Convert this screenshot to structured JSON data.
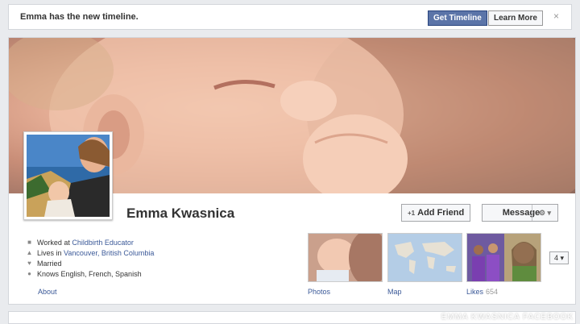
{
  "notice": {
    "text": "Emma has the new timeline.",
    "get_timeline": "Get Timeline",
    "learn_more": "Learn More",
    "close": "×"
  },
  "profile": {
    "name": "Emma Kwasnica",
    "add_friend": "Add Friend",
    "add_friend_icon": "+1",
    "message": "Message",
    "message_menu": "⚙ ▾",
    "info": {
      "work_prefix": "Worked at",
      "work_place": "Childbirth Educator",
      "lives_prefix": "Lives in",
      "lives_place": "Vancouver, British Columbia",
      "relationship": "Married",
      "languages": "Knows English, French, Spanish"
    },
    "about": "About",
    "tiles": {
      "photos": "Photos",
      "map": "Map",
      "likes": "Likes",
      "likes_count": "654"
    },
    "more": "4 ▾"
  },
  "watermark": "EMMA KWASNICA FACEBOOK",
  "colors": {
    "fb_blue": "#3b5998",
    "button_blue": "#5b74a8",
    "background": "#e9ebee"
  }
}
